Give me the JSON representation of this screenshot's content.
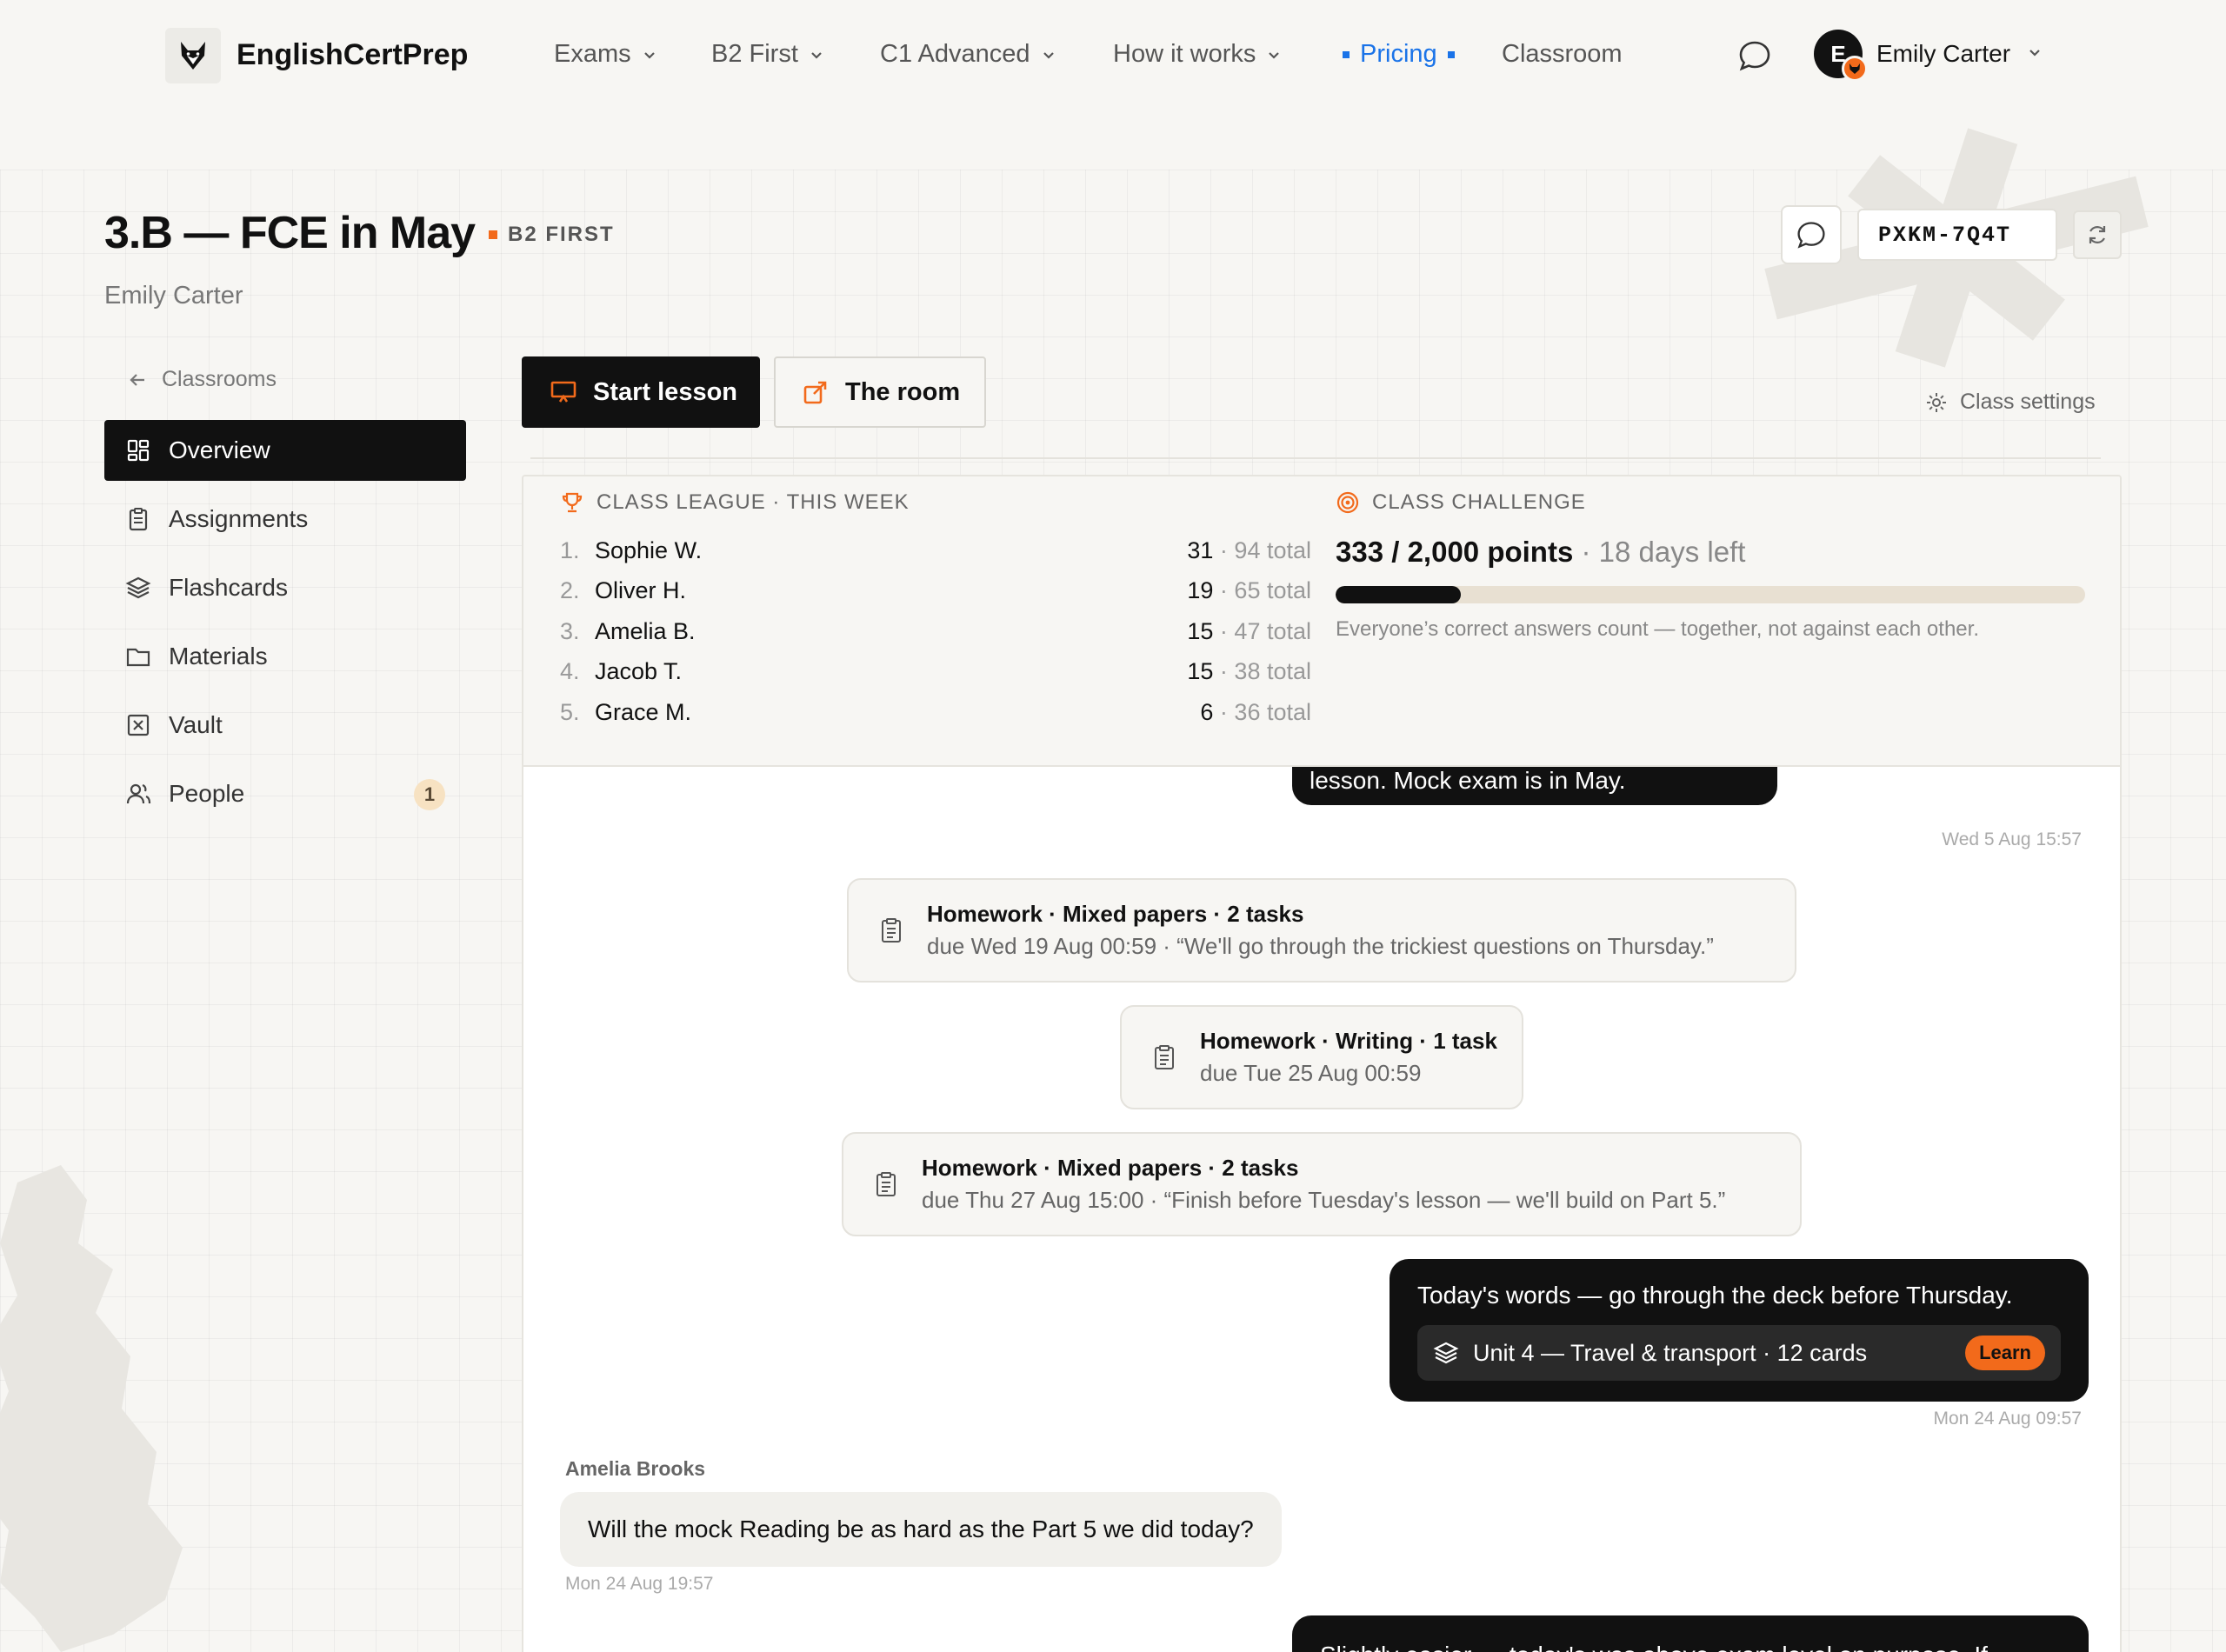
{
  "brand": {
    "name": "EnglishCertPrep",
    "logo_icon": "fox-icon"
  },
  "nav": {
    "items": [
      {
        "label": "Exams",
        "has_dropdown": true
      },
      {
        "label": "B2 First",
        "has_dropdown": true
      },
      {
        "label": "C1 Advanced",
        "has_dropdown": true
      },
      {
        "label": "How it works",
        "has_dropdown": true
      },
      {
        "label": "Pricing",
        "highlight": true
      },
      {
        "label": "Classroom"
      }
    ],
    "accent_color": "#1a73e8"
  },
  "user": {
    "name": "Emily Carter",
    "initial": "E",
    "avatar_color": "#121212",
    "badge_color": "#f26a1b"
  },
  "classroom": {
    "title": "3.B — FCE in May",
    "level": "B2 FIRST",
    "teacher": "Emily Carter",
    "join_code": "PXKM-7Q4T"
  },
  "sidebar": {
    "back_label": "Classrooms",
    "items": [
      {
        "label": "Overview",
        "icon": "grid-icon",
        "active": true
      },
      {
        "label": "Assignments",
        "icon": "clipboard-icon"
      },
      {
        "label": "Flashcards",
        "icon": "layers-icon"
      },
      {
        "label": "Materials",
        "icon": "folder-icon"
      },
      {
        "label": "Vault",
        "icon": "vault-icon"
      },
      {
        "label": "People",
        "icon": "people-icon",
        "badge": "1"
      }
    ]
  },
  "actions": {
    "start_lesson": "Start lesson",
    "the_room": "The room",
    "class_settings": "Class settings"
  },
  "league": {
    "heading": "CLASS LEAGUE · THIS WEEK",
    "rows": [
      {
        "rank": "1.",
        "name": "Sophie W.",
        "points": "31",
        "total": "94 total"
      },
      {
        "rank": "2.",
        "name": "Oliver H.",
        "points": "19",
        "total": "65 total"
      },
      {
        "rank": "3.",
        "name": "Amelia B.",
        "points": "15",
        "total": "47 total"
      },
      {
        "rank": "4.",
        "name": "Jacob T.",
        "points": "15",
        "total": "38 total"
      },
      {
        "rank": "5.",
        "name": "Grace M.",
        "points": "6",
        "total": "36 total"
      }
    ]
  },
  "challenge": {
    "heading": "CLASS CHALLENGE",
    "points_text": "333 / 2,000 points",
    "days_left": "18 days left",
    "progress": 0.1665,
    "note": "Everyone’s correct answers count — together, not against each other."
  },
  "feed": {
    "msg1": {
      "text": "lesson. Mock exam is in May.",
      "time": "Wed 5 Aug 15:57"
    },
    "hw1": {
      "title": "Homework · Mixed papers · 2 tasks",
      "sub": "due Wed 19 Aug 00:59 · “We'll go through the trickiest questions on Thursday.”"
    },
    "hw2": {
      "title": "Homework · Writing · 1 task",
      "sub": "due Tue 25 Aug 00:59"
    },
    "hw3": {
      "title": "Homework · Mixed papers · 2 tasks",
      "sub": "due Thu 27 Aug 15:00 · “Finish before Tuesday's lesson — we'll build on Part 5.”"
    },
    "msg2": {
      "text": "Today's words — go through the deck before Thursday.",
      "deck": "Unit 4 — Travel & transport · 12 cards",
      "learn": "Learn",
      "time": "Mon 24 Aug 09:57"
    },
    "reply": {
      "sender": "Amelia Brooks",
      "text": "Will the mock Reading be as hard as the Part 5 we did today?",
      "time": "Mon 24 Aug 19:57"
    },
    "msg3": {
      "text": "Slightly easier — today's was above exam level on purpose. If"
    }
  }
}
